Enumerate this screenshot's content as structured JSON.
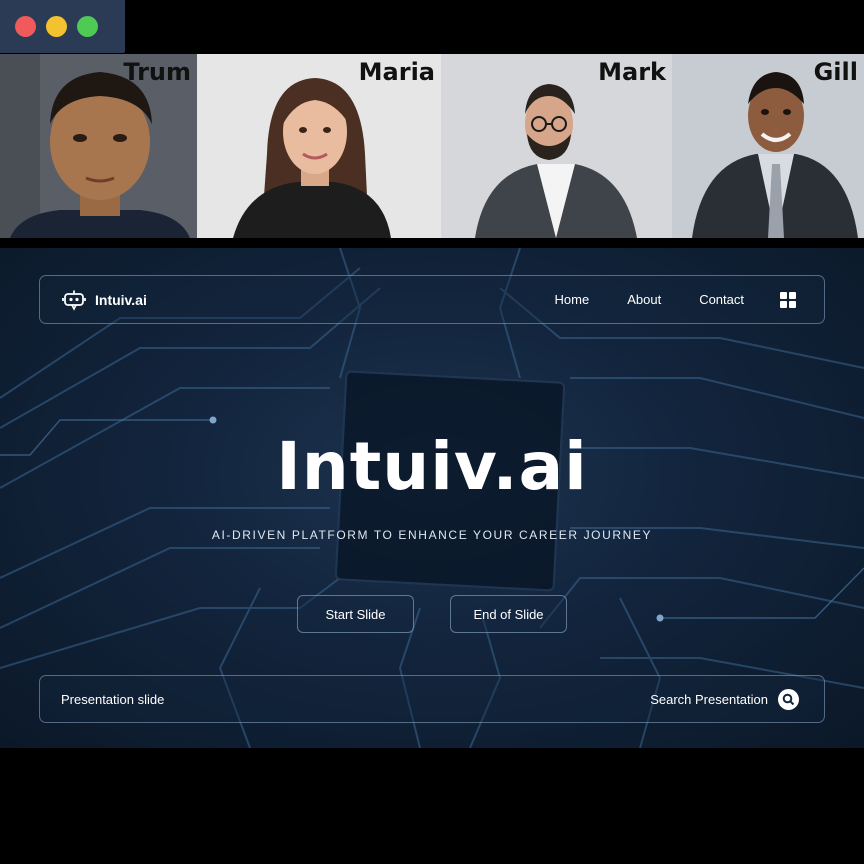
{
  "window": {
    "controls": [
      "close",
      "minimize",
      "maximize"
    ]
  },
  "participants": [
    {
      "name": "Trum",
      "bg": "#5a5e66",
      "skin": "#a8764e",
      "hair": "#1e1712",
      "shirt": "#1a2434"
    },
    {
      "name": "Maria",
      "bg": "#e6e6e6",
      "skin": "#e9bca0",
      "hair": "#4a2f22",
      "shirt": "#1d1d1d"
    },
    {
      "name": "Mark",
      "bg": "#d5d7da",
      "skin": "#d7a589",
      "hair": "#2a221c",
      "shirt": "#3e4449"
    },
    {
      "name": "Gill",
      "bg": "#c7ccd2",
      "skin": "#8d5c3e",
      "hair": "#1a1310",
      "shirt": "#2a2f36"
    }
  ],
  "presentation": {
    "brand": "Intuiv.ai",
    "nav": [
      "Home",
      "About",
      "Contact"
    ],
    "title": "Intuiv.ai",
    "subtitle": "AI-DRIVEN PLATFORM TO ENHANCE YOUR CAREER JOURNEY",
    "buttons": {
      "start": "Start Slide",
      "end": "End of Slide"
    },
    "search": {
      "left_label": "Presentation slide",
      "right_label": "Search Presentation"
    }
  }
}
